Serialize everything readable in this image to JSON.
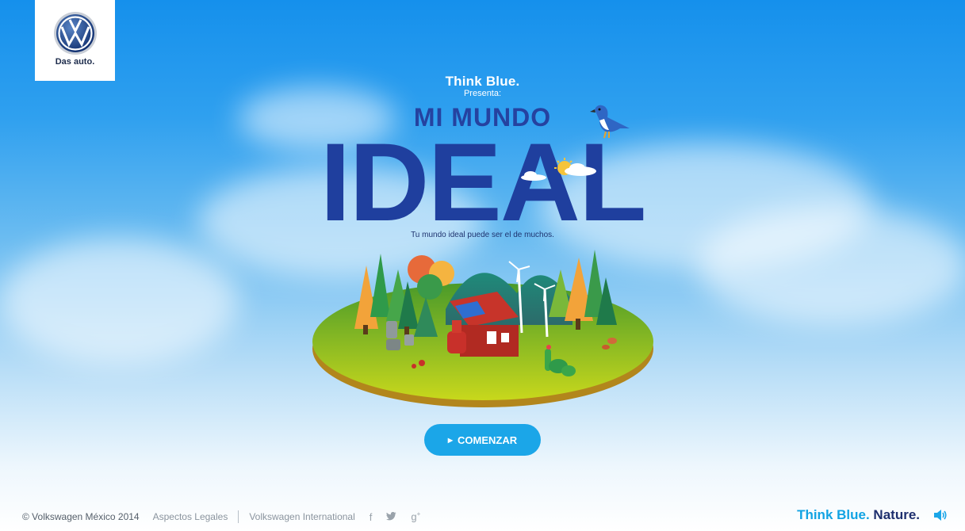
{
  "brand": {
    "tagline": "Das auto."
  },
  "hero": {
    "brand_line": "Think Blue.",
    "presenta": "Presenta:",
    "title_small": "MI MUNDO",
    "title_big": "IDEAL",
    "subtitle": "Tu mundo ideal puede ser el de muchos."
  },
  "cta": {
    "label": "COMENZAR"
  },
  "footer": {
    "copyright": "© Volkswagen México 2014",
    "legal": "Aspectos Legales",
    "international": "Volkswagen International",
    "social": [
      "facebook-icon",
      "twitter-icon",
      "google-plus-icon"
    ],
    "brand_think": "Think Blue.",
    "brand_nature": "Nature."
  },
  "colors": {
    "sky_top": "#1590ec",
    "title_blue": "#1f3f9e",
    "button": "#1ba6e8",
    "think_blue": "#12a3e3",
    "nature_navy": "#1e2f6e"
  }
}
